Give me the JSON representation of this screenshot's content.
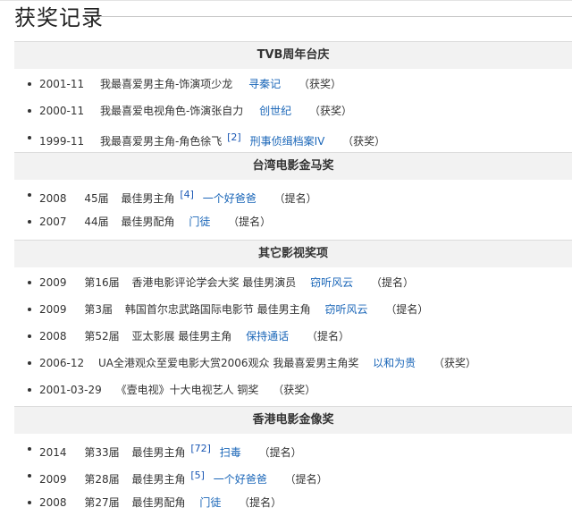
{
  "page_title": "获奖记录",
  "sections": [
    {
      "name": "TVB周年台庆",
      "rows": [
        {
          "date": "2001-11",
          "edition": "",
          "award": "我最喜爱男主角-饰演项少龙",
          "ref": "",
          "work": "寻秦记",
          "result": "（获奖）"
        },
        {
          "date": "2000-11",
          "edition": "",
          "award": "我最喜爱电视角色-饰演张自力",
          "ref": "",
          "work": "创世纪",
          "result": "（获奖）"
        },
        {
          "date": "1999-11",
          "edition": "",
          "award": "我最喜爱男主角-角色徐飞",
          "ref": "[2]",
          "work": "刑事侦缉档案IV",
          "result": "（获奖）"
        }
      ]
    },
    {
      "name": "台湾电影金马奖",
      "rows": [
        {
          "date": "2008",
          "edition": "45届",
          "award": "最佳男主角",
          "ref": "[4]",
          "work": "一个好爸爸",
          "result": "（提名）"
        },
        {
          "date": "2007",
          "edition": "44届",
          "award": "最佳男配角",
          "ref": "",
          "work": "门徒",
          "result": "（提名）"
        }
      ]
    },
    {
      "name": "其它影视奖项",
      "rows": [
        {
          "date": "2009",
          "edition": "第16届",
          "award": "香港电影评论学会大奖 最佳男演员",
          "ref": "",
          "work": "窃听风云",
          "result": "（提名）"
        },
        {
          "date": "2009",
          "edition": "第3届",
          "award": "韩国首尔忠武路国际电影节 最佳男主角",
          "ref": "",
          "work": "窃听风云",
          "result": "（提名）"
        },
        {
          "date": "2008",
          "edition": "第52届",
          "award": "亚太影展 最佳男主角",
          "ref": "",
          "work": "保持通话",
          "result": "（提名）"
        },
        {
          "date": "2006-12",
          "edition": "",
          "award": "UA全港观众至爱电影大赏2006观众 我最喜爱男主角奖",
          "ref": "",
          "work": "以和为贵",
          "result": "（获奖）"
        },
        {
          "date": "2001-03-29",
          "edition": "",
          "award": "《壹电视》十大电视艺人 铜奖",
          "ref": "",
          "work": "",
          "result": "（获奖）"
        }
      ]
    },
    {
      "name": "香港电影金像奖",
      "rows": [
        {
          "date": "2014",
          "edition": "第33届",
          "award": "最佳男主角",
          "ref": "[72]",
          "work": "扫毒",
          "result": "（提名）"
        },
        {
          "date": "2009",
          "edition": "第28届",
          "award": "最佳男主角",
          "ref": "[5]",
          "work": "一个好爸爸",
          "result": "（提名）"
        },
        {
          "date": "2008",
          "edition": "第27届",
          "award": "最佳男配角",
          "ref": "",
          "work": "门徒",
          "result": "（提名）"
        }
      ]
    }
  ]
}
